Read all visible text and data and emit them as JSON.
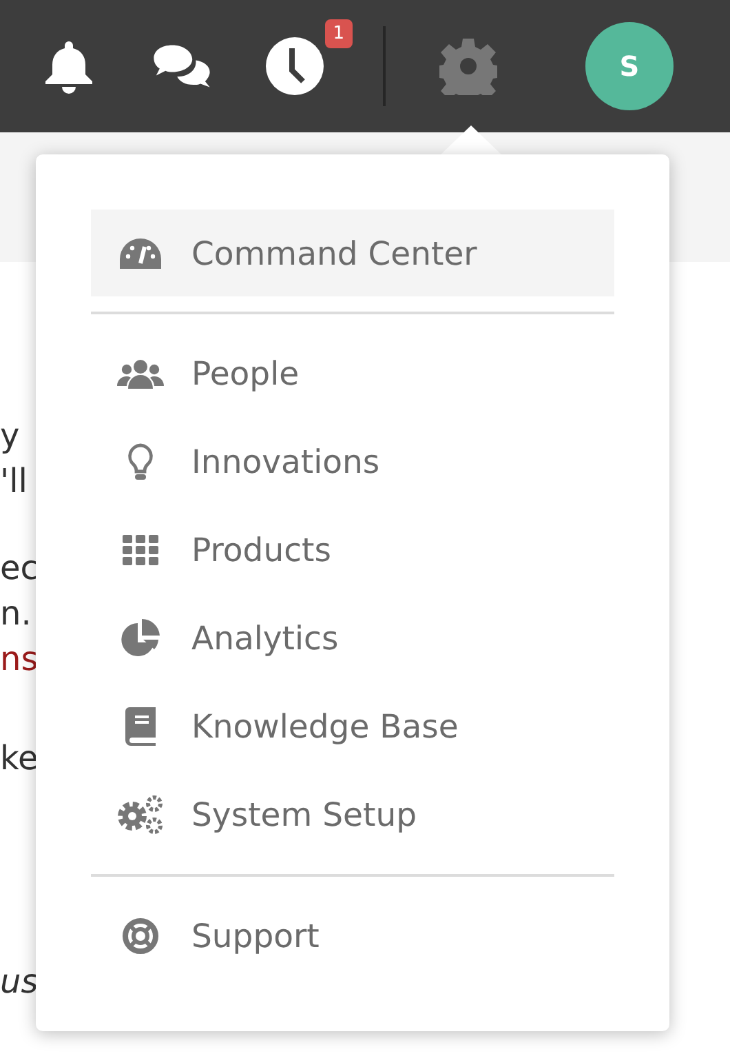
{
  "topbar": {
    "icons": [
      {
        "kind": "bell"
      },
      {
        "kind": "chat"
      },
      {
        "kind": "clock",
        "badge": "1"
      },
      {
        "kind": "gear",
        "selected": true
      }
    ],
    "avatar": "S"
  },
  "background_text": [
    {
      "lines": [
        {
          "text": "y",
          "link": false
        },
        {
          "text": "'ll",
          "link": false
        }
      ]
    },
    {
      "lines": [
        {
          "text": "ec",
          "link": false
        },
        {
          "text": "n.",
          "link": false
        },
        {
          "text": "ns",
          "link": true
        }
      ]
    },
    {
      "lines": [
        {
          "text": "ke",
          "link": false
        }
      ]
    },
    {
      "lines": [
        {
          "text": "us",
          "link": false,
          "italic": true
        }
      ]
    }
  ],
  "menu": {
    "groups": [
      [
        {
          "label": "Command Center",
          "selected": true
        }
      ],
      [
        {
          "label": "People",
          "selected": false
        },
        {
          "label": "Innovations",
          "selected": false
        },
        {
          "label": "Products",
          "selected": false
        },
        {
          "label": "Analytics",
          "selected": false
        },
        {
          "label": "Knowledge Base",
          "selected": false
        },
        {
          "label": "System Setup",
          "selected": false
        }
      ],
      [
        {
          "label": "Support",
          "selected": false
        }
      ]
    ]
  }
}
